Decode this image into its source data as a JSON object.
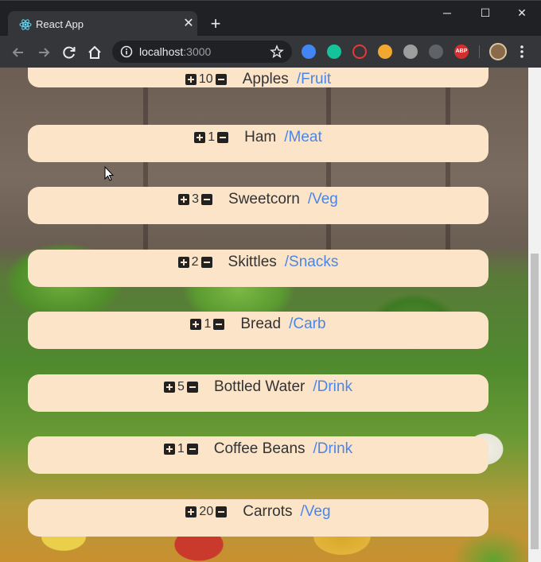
{
  "browser": {
    "tab_title": "React App",
    "url_host": "localhost",
    "url_port": ":3000",
    "extensions": [
      "q-extension-icon",
      "grammarly-icon",
      "blocker-icon",
      "owl-icon",
      "mouse-icon",
      "lightbulb-icon",
      "abp-icon"
    ],
    "abp_label": "ABP"
  },
  "items": [
    {
      "qty": "10",
      "name": "Apples",
      "category": "/Fruit"
    },
    {
      "qty": "1",
      "name": "Ham",
      "category": "/Meat"
    },
    {
      "qty": "3",
      "name": "Sweetcorn",
      "category": "/Veg"
    },
    {
      "qty": "2",
      "name": "Skittles",
      "category": "/Snacks"
    },
    {
      "qty": "1",
      "name": "Bread",
      "category": "/Carb"
    },
    {
      "qty": "5",
      "name": "Bottled Water",
      "category": "/Drink"
    },
    {
      "qty": "1",
      "name": "Coffee Beans",
      "category": "/Drink"
    },
    {
      "qty": "20",
      "name": "Carrots",
      "category": "/Veg"
    }
  ]
}
